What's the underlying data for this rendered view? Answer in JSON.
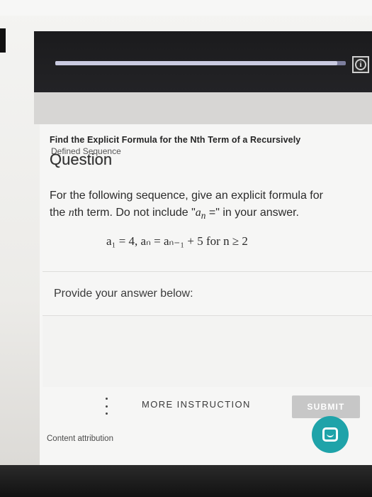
{
  "header": {
    "progress_fraction": 0.97,
    "info_icon": "info-icon",
    "info_glyph": "i"
  },
  "content": {
    "title": "Find the Explicit Formula for the Nth Term of a Recursively",
    "title_line2_partial": "Defined Sequence",
    "heading": "Question",
    "question_line1": "For the following sequence, give an explicit formula for",
    "question_line2_pre": "the ",
    "question_line2_n": "n",
    "question_line2_mid": "th term. Do not include \"",
    "question_line2_an": "a",
    "question_line2_sub": "n",
    "question_line2_post": " =\" in your answer.",
    "formula": "a₁ = 4,  aₙ = aₙ₋₁ + 5 for n ≥ 2",
    "prompt": "Provide your answer below:"
  },
  "footer": {
    "more_label": "MORE INSTRUCTION",
    "submit_label": "SUBMIT",
    "attribution": "Content attribution",
    "menu_icon": "kebab-menu-icon",
    "chat_icon": "chat-icon"
  },
  "colors": {
    "accent_teal": "#1fa3a9",
    "submit_disabled": "#c7c7c7",
    "header_dark": "#1b1b1d"
  }
}
